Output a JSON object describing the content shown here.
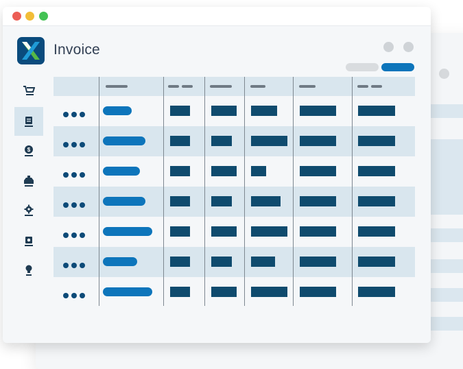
{
  "app": {
    "title": "Invoice"
  },
  "window_controls": [
    "window-control",
    "window-control"
  ],
  "sidebar": {
    "items": [
      {
        "name": "sidebar-item-cart",
        "icon": "cart-icon",
        "active": false
      },
      {
        "name": "sidebar-item-invoice",
        "icon": "invoice-icon",
        "active": true
      },
      {
        "name": "sidebar-item-payments",
        "icon": "dollar-coin-icon",
        "active": false
      },
      {
        "name": "sidebar-item-inbox",
        "icon": "inbox-tray-icon",
        "active": false
      },
      {
        "name": "sidebar-item-settings",
        "icon": "gear-icon",
        "active": false
      },
      {
        "name": "sidebar-item-print",
        "icon": "printer-icon",
        "active": false
      },
      {
        "name": "sidebar-item-ideas",
        "icon": "lightbulb-icon",
        "active": false
      }
    ]
  },
  "colors": {
    "accent": "#0d75bb",
    "cell": "#0f4b6e",
    "row_shade": "#d9e6ee",
    "active_nav": "#d7e5ee",
    "traffic_red": "#ec5e55",
    "traffic_yellow": "#f2bd38",
    "traffic_green": "#44c254"
  },
  "table": {
    "row_count": 7,
    "shaded_rows": [
      1,
      3,
      5
    ],
    "column_count": 7
  }
}
